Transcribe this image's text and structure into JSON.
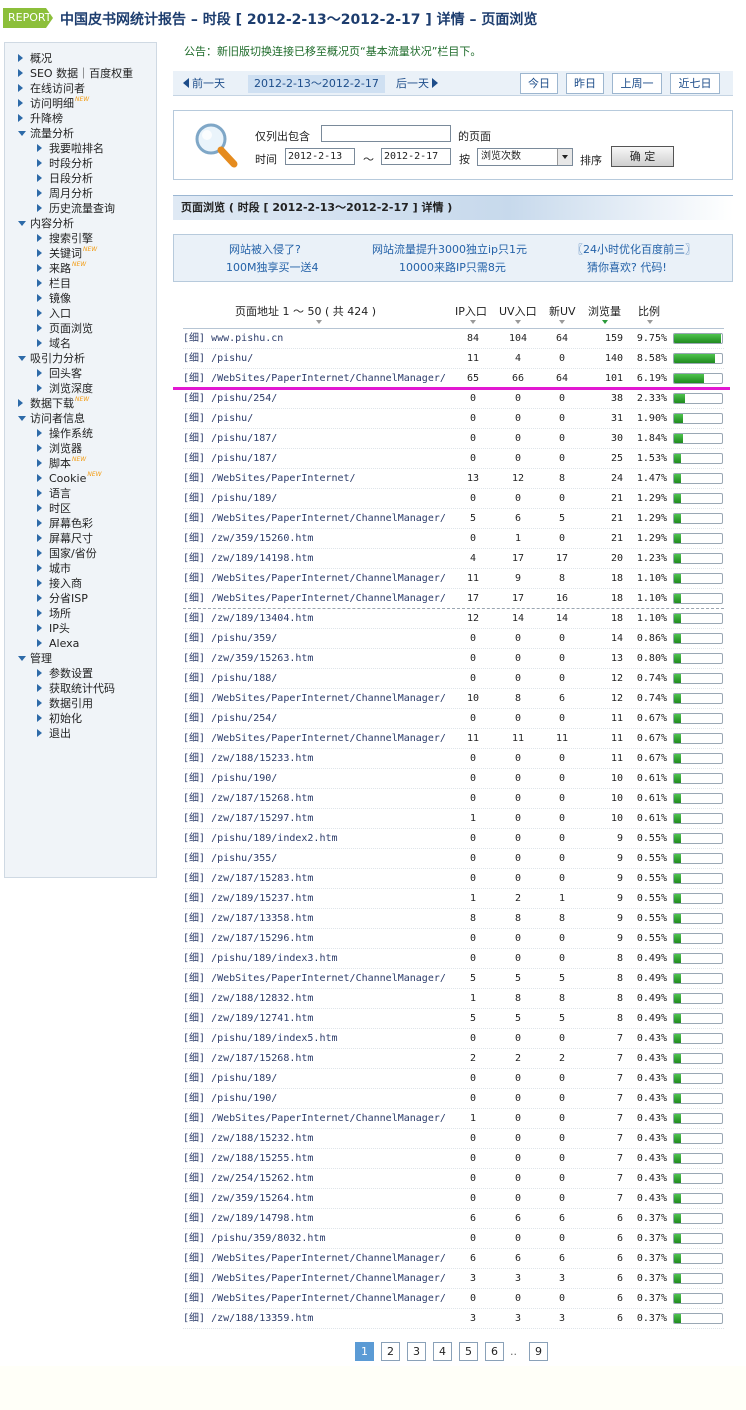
{
  "header": {
    "logo_text": "REPORT",
    "title": "中国皮书网统计报告 – 时段 [ 2012-2-13～2012-2-17 ] 详情 – 页面浏览"
  },
  "sidebar": {
    "items": [
      {
        "label": "概况",
        "level": 1,
        "icon": "triangle-right-icon"
      },
      {
        "label": "SEO 数据｜百度权重",
        "level": 1,
        "icon": "triangle-right-icon"
      },
      {
        "label": "在线访问者",
        "level": 1,
        "icon": "triangle-right-icon"
      },
      {
        "label": "访问明细",
        "level": 1,
        "icon": "triangle-right-icon",
        "badge": "NEW"
      },
      {
        "label": "升降榜",
        "level": 1,
        "icon": "triangle-right-icon"
      },
      {
        "label": "流量分析",
        "level": 1,
        "icon": "triangle-down-icon"
      },
      {
        "label": "我要啦排名",
        "level": 2,
        "icon": "triangle-right-icon"
      },
      {
        "label": "时段分析",
        "level": 2,
        "icon": "triangle-right-icon"
      },
      {
        "label": "日段分析",
        "level": 2,
        "icon": "triangle-right-icon"
      },
      {
        "label": "周月分析",
        "level": 2,
        "icon": "triangle-right-icon"
      },
      {
        "label": "历史流量查询",
        "level": 2,
        "icon": "triangle-right-icon"
      },
      {
        "label": "内容分析",
        "level": 1,
        "icon": "triangle-down-icon"
      },
      {
        "label": "搜索引擎",
        "level": 2,
        "icon": "triangle-right-icon"
      },
      {
        "label": "关键词",
        "level": 2,
        "icon": "triangle-right-icon",
        "badge": "NEW"
      },
      {
        "label": "来路",
        "level": 2,
        "icon": "triangle-right-icon",
        "badge": "NEW"
      },
      {
        "label": "栏目",
        "level": 2,
        "icon": "triangle-right-icon"
      },
      {
        "label": "镜像",
        "level": 2,
        "icon": "triangle-right-icon"
      },
      {
        "label": "入口",
        "level": 2,
        "icon": "triangle-right-icon"
      },
      {
        "label": "页面浏览",
        "level": 2,
        "icon": "triangle-right-icon"
      },
      {
        "label": "域名",
        "level": 2,
        "icon": "triangle-right-icon"
      },
      {
        "label": "吸引力分析",
        "level": 1,
        "icon": "triangle-down-icon"
      },
      {
        "label": "回头客",
        "level": 2,
        "icon": "triangle-right-icon"
      },
      {
        "label": "浏览深度",
        "level": 2,
        "icon": "triangle-right-icon"
      },
      {
        "label": "数据下载",
        "level": 1,
        "icon": "triangle-right-icon",
        "badge": "NEW"
      },
      {
        "label": "访问者信息",
        "level": 1,
        "icon": "triangle-down-icon"
      },
      {
        "label": "操作系统",
        "level": 2,
        "icon": "triangle-right-icon"
      },
      {
        "label": "浏览器",
        "level": 2,
        "icon": "triangle-right-icon"
      },
      {
        "label": "脚本",
        "level": 2,
        "icon": "triangle-right-icon",
        "badge": "NEW"
      },
      {
        "label": "Cookie",
        "level": 2,
        "icon": "triangle-right-icon",
        "badge": "NEW"
      },
      {
        "label": "语言",
        "level": 2,
        "icon": "triangle-right-icon"
      },
      {
        "label": "时区",
        "level": 2,
        "icon": "triangle-right-icon"
      },
      {
        "label": "屏幕色彩",
        "level": 2,
        "icon": "triangle-right-icon"
      },
      {
        "label": "屏幕尺寸",
        "level": 2,
        "icon": "triangle-right-icon"
      },
      {
        "label": "国家/省份",
        "level": 2,
        "icon": "triangle-right-icon"
      },
      {
        "label": "城市",
        "level": 2,
        "icon": "triangle-right-icon"
      },
      {
        "label": "接入商",
        "level": 2,
        "icon": "triangle-right-icon"
      },
      {
        "label": "分省ISP",
        "level": 2,
        "icon": "triangle-right-icon"
      },
      {
        "label": "场所",
        "level": 2,
        "icon": "triangle-right-icon"
      },
      {
        "label": "IP头",
        "level": 2,
        "icon": "triangle-right-icon"
      },
      {
        "label": "Alexa",
        "level": 2,
        "icon": "triangle-right-icon"
      },
      {
        "label": "管理",
        "level": 1,
        "icon": "triangle-down-icon"
      },
      {
        "label": "参数设置",
        "level": 2,
        "icon": "triangle-right-icon"
      },
      {
        "label": "获取统计代码",
        "level": 2,
        "icon": "triangle-right-icon"
      },
      {
        "label": "数据引用",
        "level": 2,
        "icon": "triangle-right-icon"
      },
      {
        "label": "初始化",
        "level": 2,
        "icon": "triangle-right-icon"
      },
      {
        "label": "退出",
        "level": 2,
        "icon": "triangle-right-icon"
      }
    ]
  },
  "notice": "公告：新旧版切换连接已移至概况页“基本流量状况”栏目下。",
  "datebar": {
    "prev": "前一天",
    "current": "2012-2-13～2012-2-17",
    "next": "后一天",
    "quick": [
      "今日",
      "昨日",
      "上周一",
      "近七日"
    ]
  },
  "filter": {
    "contains_label": "仅列出包含",
    "contains_value": "",
    "page_suffix": "的页面",
    "time_label": "时间",
    "date_from": "2012-2-13",
    "date_sep": "～",
    "date_to": "2012-2-17",
    "by_label": "按",
    "sort_by": "浏览次数",
    "sort_label": "排序",
    "ok": "确 定",
    "icon": "magnifier-icon"
  },
  "section_title": "页面浏览 ( 时段 [ 2012-2-13～2012-2-17 ] 详情 )",
  "ads": {
    "row1": [
      "网站被入侵了?",
      "网站流量提升3000独立ip只1元",
      "〖24小时优化百度前三〗"
    ],
    "row2": [
      "100M独享买一送4",
      "10000来路IP只需8元",
      "猜你喜欢? 代码!"
    ]
  },
  "table": {
    "headers": {
      "url": "页面地址 1 ～ 50 ( 共 424 )",
      "ip": "IP入口",
      "uv": "UV入口",
      "new_uv": "新UV",
      "pv": "浏览量",
      "pct": "比例"
    },
    "detail_label": "[细]",
    "rows": [
      {
        "url": "www.pishu.cn",
        "ip": "84",
        "uv": "104",
        "nuv": "64",
        "pv": "159",
        "pct": "9.75%",
        "fill": 0.975
      },
      {
        "url": "/pishu/",
        "ip": "11",
        "uv": "4",
        "nuv": "0",
        "pv": "140",
        "pct": "8.58%",
        "fill": 0.858
      },
      {
        "url": "/WebSites/PaperInternet/ChannelManager/",
        "ip": "65",
        "uv": "66",
        "nuv": "64",
        "pv": "101",
        "pct": "6.19%",
        "fill": 0.619
      },
      {
        "url": "/pishu/254/",
        "ip": "0",
        "uv": "0",
        "nuv": "0",
        "pv": "38",
        "pct": "2.33%",
        "fill": 0.233
      },
      {
        "url": "/pishu/",
        "ip": "0",
        "uv": "0",
        "nuv": "0",
        "pv": "31",
        "pct": "1.90%",
        "fill": 0.19
      },
      {
        "url": "/pishu/187/",
        "ip": "0",
        "uv": "0",
        "nuv": "0",
        "pv": "30",
        "pct": "1.84%",
        "fill": 0.184
      },
      {
        "url": "/pishu/187/",
        "ip": "0",
        "uv": "0",
        "nuv": "0",
        "pv": "25",
        "pct": "1.53%",
        "fill": 0.153
      },
      {
        "url": "/WebSites/PaperInternet/",
        "ip": "13",
        "uv": "12",
        "nuv": "8",
        "pv": "24",
        "pct": "1.47%",
        "fill": 0.147
      },
      {
        "url": "/pishu/189/",
        "ip": "0",
        "uv": "0",
        "nuv": "0",
        "pv": "21",
        "pct": "1.29%",
        "fill": 0.129
      },
      {
        "url": "/WebSites/PaperInternet/ChannelManager/",
        "ip": "5",
        "uv": "6",
        "nuv": "5",
        "pv": "21",
        "pct": "1.29%",
        "fill": 0.129
      },
      {
        "url": "/zw/359/15260.htm",
        "ip": "0",
        "uv": "1",
        "nuv": "0",
        "pv": "21",
        "pct": "1.29%",
        "fill": 0.129
      },
      {
        "url": "/zw/189/14198.htm",
        "ip": "4",
        "uv": "17",
        "nuv": "17",
        "pv": "20",
        "pct": "1.23%",
        "fill": 0.123
      },
      {
        "url": "/WebSites/PaperInternet/ChannelManager/",
        "ip": "11",
        "uv": "9",
        "nuv": "8",
        "pv": "18",
        "pct": "1.10%",
        "fill": 0.11
      },
      {
        "url": "/WebSites/PaperInternet/ChannelManager/",
        "ip": "17",
        "uv": "17",
        "nuv": "16",
        "pv": "18",
        "pct": "1.10%",
        "fill": 0.11
      },
      {
        "url": "/zw/189/13404.htm",
        "ip": "12",
        "uv": "14",
        "nuv": "14",
        "pv": "18",
        "pct": "1.10%",
        "fill": 0.11
      },
      {
        "url": "/pishu/359/",
        "ip": "0",
        "uv": "0",
        "nuv": "0",
        "pv": "14",
        "pct": "0.86%",
        "fill": 0.086
      },
      {
        "url": "/zw/359/15263.htm",
        "ip": "0",
        "uv": "0",
        "nuv": "0",
        "pv": "13",
        "pct": "0.80%",
        "fill": 0.08
      },
      {
        "url": "/pishu/188/",
        "ip": "0",
        "uv": "0",
        "nuv": "0",
        "pv": "12",
        "pct": "0.74%",
        "fill": 0.074
      },
      {
        "url": "/WebSites/PaperInternet/ChannelManager/",
        "ip": "10",
        "uv": "8",
        "nuv": "6",
        "pv": "12",
        "pct": "0.74%",
        "fill": 0.074
      },
      {
        "url": "/pishu/254/",
        "ip": "0",
        "uv": "0",
        "nuv": "0",
        "pv": "11",
        "pct": "0.67%",
        "fill": 0.067
      },
      {
        "url": "/WebSites/PaperInternet/ChannelManager/",
        "ip": "11",
        "uv": "11",
        "nuv": "11",
        "pv": "11",
        "pct": "0.67%",
        "fill": 0.067
      },
      {
        "url": "/zw/188/15233.htm",
        "ip": "0",
        "uv": "0",
        "nuv": "0",
        "pv": "11",
        "pct": "0.67%",
        "fill": 0.067
      },
      {
        "url": "/pishu/190/",
        "ip": "0",
        "uv": "0",
        "nuv": "0",
        "pv": "10",
        "pct": "0.61%",
        "fill": 0.061
      },
      {
        "url": "/zw/187/15268.htm",
        "ip": "0",
        "uv": "0",
        "nuv": "0",
        "pv": "10",
        "pct": "0.61%",
        "fill": 0.061
      },
      {
        "url": "/zw/187/15297.htm",
        "ip": "1",
        "uv": "0",
        "nuv": "0",
        "pv": "10",
        "pct": "0.61%",
        "fill": 0.061
      },
      {
        "url": "/pishu/189/index2.htm",
        "ip": "0",
        "uv": "0",
        "nuv": "0",
        "pv": "9",
        "pct": "0.55%",
        "fill": 0.055
      },
      {
        "url": "/pishu/355/",
        "ip": "0",
        "uv": "0",
        "nuv": "0",
        "pv": "9",
        "pct": "0.55%",
        "fill": 0.055
      },
      {
        "url": "/zw/187/15283.htm",
        "ip": "0",
        "uv": "0",
        "nuv": "0",
        "pv": "9",
        "pct": "0.55%",
        "fill": 0.055
      },
      {
        "url": "/zw/189/15237.htm",
        "ip": "1",
        "uv": "2",
        "nuv": "1",
        "pv": "9",
        "pct": "0.55%",
        "fill": 0.055
      },
      {
        "url": "/zw/187/13358.htm",
        "ip": "8",
        "uv": "8",
        "nuv": "8",
        "pv": "9",
        "pct": "0.55%",
        "fill": 0.055
      },
      {
        "url": "/zw/187/15296.htm",
        "ip": "0",
        "uv": "0",
        "nuv": "0",
        "pv": "9",
        "pct": "0.55%",
        "fill": 0.055
      },
      {
        "url": "/pishu/189/index3.htm",
        "ip": "0",
        "uv": "0",
        "nuv": "0",
        "pv": "8",
        "pct": "0.49%",
        "fill": 0.049
      },
      {
        "url": "/WebSites/PaperInternet/ChannelManager/",
        "ip": "5",
        "uv": "5",
        "nuv": "5",
        "pv": "8",
        "pct": "0.49%",
        "fill": 0.049
      },
      {
        "url": "/zw/188/12832.htm",
        "ip": "1",
        "uv": "8",
        "nuv": "8",
        "pv": "8",
        "pct": "0.49%",
        "fill": 0.049
      },
      {
        "url": "/zw/189/12741.htm",
        "ip": "5",
        "uv": "5",
        "nuv": "5",
        "pv": "8",
        "pct": "0.49%",
        "fill": 0.049
      },
      {
        "url": "/pishu/189/index5.htm",
        "ip": "0",
        "uv": "0",
        "nuv": "0",
        "pv": "7",
        "pct": "0.43%",
        "fill": 0.043
      },
      {
        "url": "/zw/187/15268.htm",
        "ip": "2",
        "uv": "2",
        "nuv": "2",
        "pv": "7",
        "pct": "0.43%",
        "fill": 0.043
      },
      {
        "url": "/pishu/189/",
        "ip": "0",
        "uv": "0",
        "nuv": "0",
        "pv": "7",
        "pct": "0.43%",
        "fill": 0.043
      },
      {
        "url": "/pishu/190/",
        "ip": "0",
        "uv": "0",
        "nuv": "0",
        "pv": "7",
        "pct": "0.43%",
        "fill": 0.043
      },
      {
        "url": "/WebSites/PaperInternet/ChannelManager/",
        "ip": "1",
        "uv": "0",
        "nuv": "0",
        "pv": "7",
        "pct": "0.43%",
        "fill": 0.043
      },
      {
        "url": "/zw/188/15232.htm",
        "ip": "0",
        "uv": "0",
        "nuv": "0",
        "pv": "7",
        "pct": "0.43%",
        "fill": 0.043
      },
      {
        "url": "/zw/188/15255.htm",
        "ip": "0",
        "uv": "0",
        "nuv": "0",
        "pv": "7",
        "pct": "0.43%",
        "fill": 0.043
      },
      {
        "url": "/zw/254/15262.htm",
        "ip": "0",
        "uv": "0",
        "nuv": "0",
        "pv": "7",
        "pct": "0.43%",
        "fill": 0.043
      },
      {
        "url": "/zw/359/15264.htm",
        "ip": "0",
        "uv": "0",
        "nuv": "0",
        "pv": "7",
        "pct": "0.43%",
        "fill": 0.043
      },
      {
        "url": "/zw/189/14798.htm",
        "ip": "6",
        "uv": "6",
        "nuv": "6",
        "pv": "6",
        "pct": "0.37%",
        "fill": 0.037
      },
      {
        "url": "/pishu/359/8032.htm",
        "ip": "0",
        "uv": "0",
        "nuv": "0",
        "pv": "6",
        "pct": "0.37%",
        "fill": 0.037
      },
      {
        "url": "/WebSites/PaperInternet/ChannelManager/",
        "ip": "6",
        "uv": "6",
        "nuv": "6",
        "pv": "6",
        "pct": "0.37%",
        "fill": 0.037
      },
      {
        "url": "/WebSites/PaperInternet/ChannelManager/",
        "ip": "3",
        "uv": "3",
        "nuv": "3",
        "pv": "6",
        "pct": "0.37%",
        "fill": 0.037
      },
      {
        "url": "/WebSites/PaperInternet/ChannelManager/",
        "ip": "0",
        "uv": "0",
        "nuv": "0",
        "pv": "6",
        "pct": "0.37%",
        "fill": 0.037
      },
      {
        "url": "/zw/188/13359.htm",
        "ip": "3",
        "uv": "3",
        "nuv": "3",
        "pv": "6",
        "pct": "0.37%",
        "fill": 0.037
      }
    ]
  },
  "pager": {
    "pages": [
      "1",
      "2",
      "3",
      "4",
      "5",
      "6"
    ],
    "current": "1",
    "ellipsis": "..",
    "last": "9"
  },
  "colors": {
    "logo": "#8cbf3a",
    "title": "#1d3d6e",
    "link": "#2462a8",
    "bar_fill": "#2fa82f",
    "highlight": "#e218d2",
    "pager_current": "#5b9bd5"
  }
}
